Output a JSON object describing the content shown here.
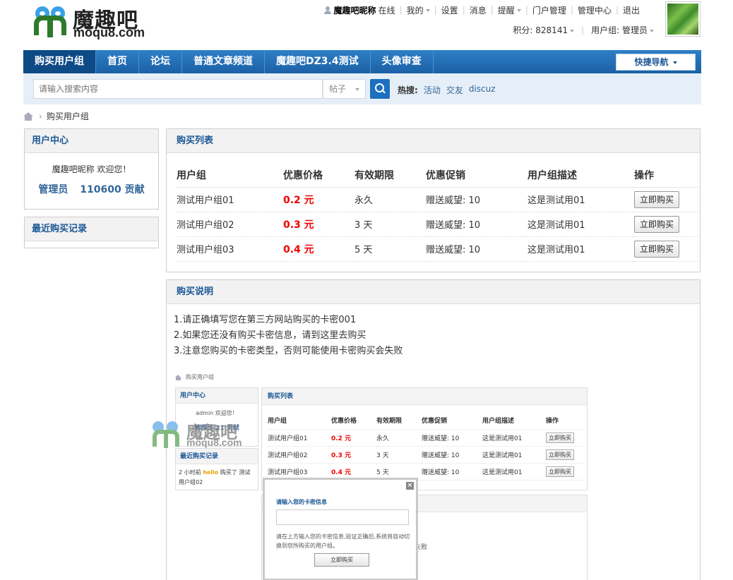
{
  "logo": {
    "cn": "魔趣吧",
    "en": "moqu8.com"
  },
  "topbar": {
    "username": "魔趣吧昵称",
    "status": "在线",
    "links": [
      "我的",
      "设置",
      "消息",
      "提醒",
      "门户管理",
      "管理中心",
      "退出"
    ]
  },
  "subbar": {
    "points": "积分: 828141",
    "usergroup": "用户组: 管理员"
  },
  "nav": {
    "items": [
      "购买用户组",
      "首页",
      "论坛",
      "普通文章频道",
      "魔趣吧DZ3.4测试",
      "头像审查"
    ],
    "quicknav": "快捷导航"
  },
  "search": {
    "placeholder": "请输入搜索内容",
    "type": "帖子",
    "hot_label": "热搜:",
    "hot": [
      "活动",
      "交友",
      "discuz"
    ]
  },
  "breadcrumb": {
    "current": "购买用户组"
  },
  "sidebar": {
    "user_center": {
      "title": "用户中心",
      "welcome": "魔趣吧昵称 欢迎您！",
      "role": "管理员",
      "contribution": "110600 贡献"
    },
    "recent": {
      "title": "最近购买记录"
    }
  },
  "buy_list": {
    "title": "购买列表",
    "headers": [
      "用户组",
      "优惠价格",
      "有效期限",
      "优惠促销",
      "用户组描述",
      "操作"
    ],
    "rows": [
      {
        "group": "测试用户组01",
        "price": "0.2 元",
        "period": "永久",
        "promo": "赠送威望: 10",
        "desc": "这是测试用01",
        "action": "立即购买"
      },
      {
        "group": "测试用户组02",
        "price": "0.3 元",
        "period": "3 天",
        "promo": "赠送威望: 10",
        "desc": "这是测试用01",
        "action": "立即购买"
      },
      {
        "group": "测试用户组03",
        "price": "0.4 元",
        "period": "5 天",
        "promo": "赠送威望: 10",
        "desc": "这是测试用01",
        "action": "立即购买"
      }
    ]
  },
  "instructions": {
    "title": "购买说明",
    "lines": [
      "1.请正确填写您在第三方网站购买的卡密001",
      "2.如果您还没有购买卡密信息，请到这里去购买",
      "3.注意您购买的卡密类型，否则可能使用卡密购买会失败"
    ]
  },
  "screenshot": {
    "breadcrumb": "购买用户组",
    "user_center": "用户中心",
    "welcome": "admin 欢迎您！",
    "stats": "管理员  21 贡献",
    "recent_title": "最近购买记录",
    "recent_pre": "2 小时前 ",
    "recent_user": "hello",
    "recent_post": " 购买了 测试用户组02",
    "list_title": "购买列表",
    "headers": [
      "用户组",
      "优惠价格",
      "有效期限",
      "优惠促销",
      "用户组描述",
      "操作"
    ],
    "rows": [
      {
        "group": "测试用户组01",
        "price": "0.2 元",
        "period": "永久",
        "promo": "赠送威望: 10",
        "desc": "这是测试用01",
        "action": "立即购买"
      },
      {
        "group": "测试用户组02",
        "price": "0.3 元",
        "period": "3 天",
        "promo": "赠送威望: 10",
        "desc": "这是测试用01",
        "action": "立即购买"
      },
      {
        "group": "测试用户组03",
        "price": "0.4 元",
        "period": "5 天",
        "promo": "赠送威望: 10",
        "desc": "这是测试用01",
        "action": "立即购买"
      }
    ],
    "fragment": "失败",
    "dialog": {
      "title": "请输入您的卡密信息",
      "tip": "请在上方输入您的卡密信息,验证正确后,系统将自动切换到您所购买的用户组。",
      "button": "立即购买"
    },
    "watermark": {
      "cn": "魔趣吧",
      "en": "moqu8.com"
    }
  }
}
